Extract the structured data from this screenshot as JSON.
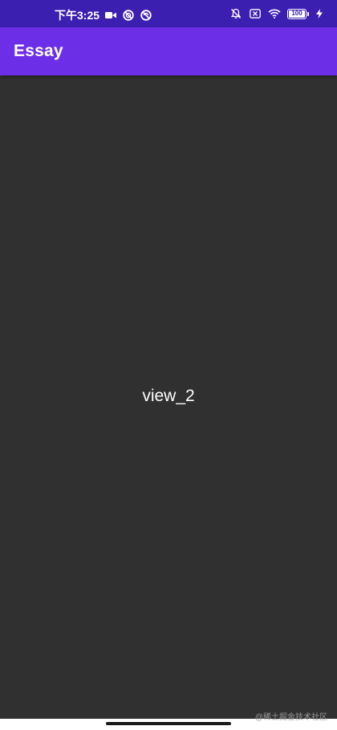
{
  "status_bar": {
    "time": "下午3:25",
    "left_icons": [
      "video-camera-icon",
      "sync-blocked-icon",
      "vpn-blocked-icon"
    ],
    "right_icons": [
      "mute-bell-icon",
      "no-sim-icon",
      "wifi-icon",
      "battery-icon",
      "charging-bolt-icon"
    ],
    "battery_text": "100",
    "battery_level": 1.0,
    "background_color": "#3b1fb0"
  },
  "app_bar": {
    "title": "Essay",
    "background_color": "#6d2ee8"
  },
  "content": {
    "label": "view_2",
    "background_color": "#303030"
  },
  "watermark": {
    "text": "@稀土掘金技术社区"
  }
}
